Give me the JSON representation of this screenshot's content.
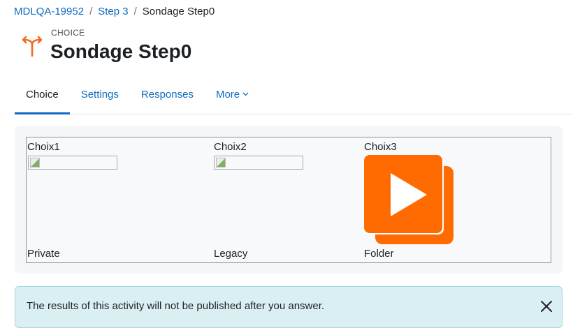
{
  "breadcrumb": {
    "items": [
      "MDLQA-19952",
      "Step 3",
      "Sondage Step0"
    ],
    "separator": "/"
  },
  "header": {
    "module_type": "CHOICE",
    "title": "Sondage Step0",
    "icon": "choice-icon"
  },
  "tabs": [
    {
      "label": "Choice",
      "active": true
    },
    {
      "label": "Settings",
      "active": false
    },
    {
      "label": "Responses",
      "active": false
    },
    {
      "label": "More",
      "active": false,
      "has_dropdown": true
    }
  ],
  "options": {
    "headers": [
      "Choix1",
      "Choix2",
      "Choix3"
    ],
    "footers": [
      "Private",
      "Legacy",
      "Folder"
    ],
    "images": [
      "broken-image",
      "broken-image",
      "orange-play-folder-icon"
    ]
  },
  "alert": {
    "text": "The results of this activity will not be published after you answer.",
    "close_icon": "close-icon"
  },
  "colors": {
    "link": "#0f6cbf",
    "accent_orange": "#ff6b00",
    "alert_bg": "#d9eff2"
  }
}
